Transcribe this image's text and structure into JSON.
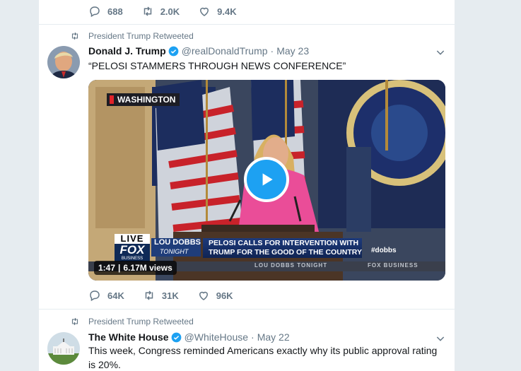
{
  "top_tweet_actions": {
    "replies": "688",
    "retweets": "2.0K",
    "likes": "9.4K"
  },
  "tweet1": {
    "retweet_context": "President Trump Retweeted",
    "name": "Donald J. Trump",
    "handle": "@realDonaldTrump",
    "separator": "·",
    "date": "May 23",
    "text": "“PELOSI STAMMERS THROUGH NEWS CONFERENCE”",
    "video": {
      "location_bug": "WASHINGTON",
      "live_label": "LIVE",
      "network": "FOX",
      "network_sub": "BUSINESS",
      "show_line1": "LOU DOBBS",
      "show_line2": "TONIGHT",
      "headline_line1": "PELOSI CALLS FOR INTERVENTION WITH",
      "headline_line2": "TRUMP FOR THE GOOD OF THE COUNTRY",
      "hashtag": "#dobbs",
      "ticker_left": "LOU DOBBS TONIGHT",
      "ticker_right": "FOX BUSINESS",
      "duration": "1:47",
      "views": "6.17M views"
    },
    "actions": {
      "replies": "64K",
      "retweets": "31K",
      "likes": "96K"
    }
  },
  "tweet2": {
    "retweet_context": "President Trump Retweeted",
    "name": "The White House",
    "handle": "@WhiteHouse",
    "separator": "·",
    "date": "May 22",
    "text": "This week, Congress reminded Americans exactly why its public approval rating is 20%."
  },
  "colors": {
    "accent": "#1da1f2",
    "muted": "#657786",
    "text": "#14171a",
    "background": "#e6ecf0"
  }
}
